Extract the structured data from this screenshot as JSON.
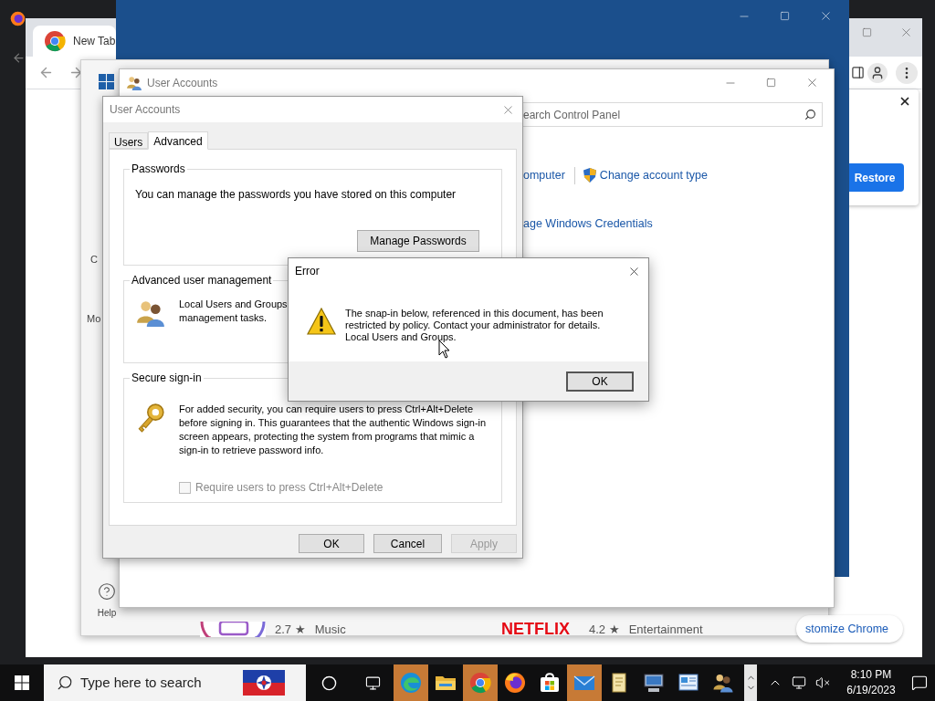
{
  "chrome": {
    "tab": {
      "title": "New Tab",
      "selected": true
    },
    "restore_card": {
      "button": "Restore"
    },
    "customize_button": "stomize Chrome"
  },
  "store_window": {
    "nav": [
      "C",
      "Mo"
    ],
    "help": "Help",
    "apps": [
      {
        "kind": "picture",
        "rating": "2.7 ★",
        "category": "Music"
      },
      {
        "kind": "wordmark",
        "wordmark": "NETFLIX",
        "rating": "4.2 ★",
        "category": "Entertainment"
      }
    ]
  },
  "control_panel": {
    "title": "User Accounts",
    "search": {
      "placeholder": "earch Control Panel"
    },
    "link_rows": [
      [
        {
          "label": "omputer",
          "shield": false
        },
        {
          "label": "Change account type",
          "shield": true
        }
      ],
      [
        {
          "label": "age Windows Credentials",
          "shield": false
        }
      ]
    ]
  },
  "user_accounts_dialog": {
    "title": "User Accounts",
    "tabs": [
      {
        "label": "Users",
        "selected": false
      },
      {
        "label": "Advanced",
        "selected": true
      }
    ],
    "groups": [
      {
        "kind": "passwords",
        "title": "Passwords",
        "text": "You can manage the passwords you have stored on this computer",
        "button": "Manage Passwords"
      },
      {
        "kind": "advanced",
        "title": "Advanced user management",
        "lines": [
          "Local Users and Groups",
          "management tasks."
        ]
      },
      {
        "kind": "secure",
        "title": "Secure sign-in",
        "text": "For added security, you can require users to press Ctrl+Alt+Delete before signing in. This guarantees that the authentic Windows sign-in screen appears, protecting the system from programs that mimic a sign-in to retrieve password info.",
        "checkbox": {
          "label": "Require users to press Ctrl+Alt+Delete",
          "checked": false,
          "disabled": true
        }
      }
    ],
    "buttons": [
      {
        "label": "OK",
        "disabled": false
      },
      {
        "label": "Cancel",
        "disabled": false
      },
      {
        "label": "Apply",
        "disabled": true
      }
    ]
  },
  "error_dialog": {
    "title": "Error",
    "message_lines": [
      "The snap-in below, referenced in this document, has been restricted by policy. Contact your administrator for details.",
      "Local Users and Groups."
    ],
    "button": "OK"
  },
  "taskbar": {
    "search": {
      "placeholder": "Type here to search"
    },
    "apps": [
      {
        "kind": "edge",
        "highlighted": true
      },
      {
        "kind": "explorer",
        "highlighted": false
      },
      {
        "kind": "chrome",
        "highlighted": true
      },
      {
        "kind": "firefox",
        "highlighted": false
      },
      {
        "kind": "store",
        "highlighted": false
      },
      {
        "kind": "mail",
        "highlighted": true
      },
      {
        "kind": "scroll",
        "highlighted": false
      },
      {
        "kind": "computer",
        "highlighted": false
      },
      {
        "kind": "panel",
        "highlighted": false
      },
      {
        "kind": "users",
        "highlighted": false
      }
    ],
    "clock": {
      "time": "8:10 PM",
      "date": "6/19/2023"
    }
  }
}
